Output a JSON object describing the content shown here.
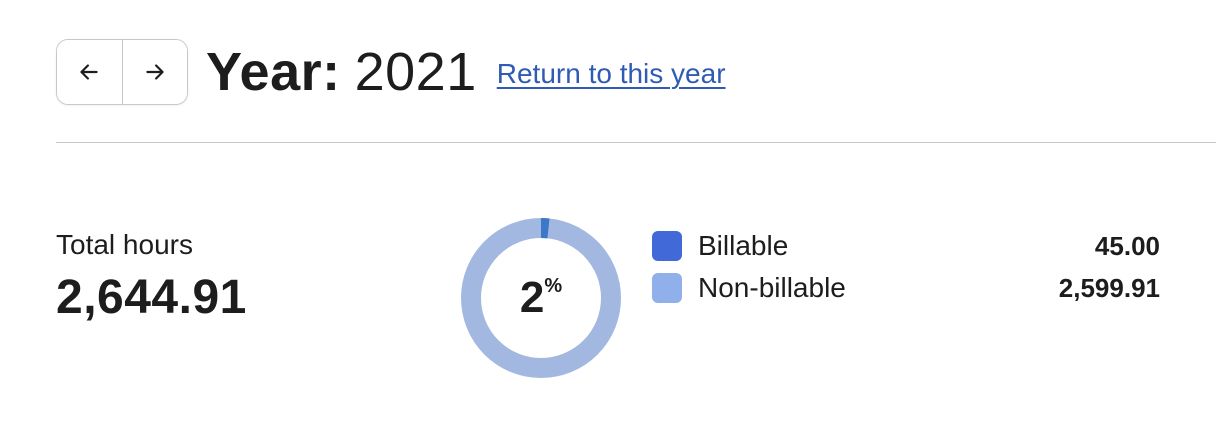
{
  "header": {
    "prev_icon": "arrow-left-icon",
    "next_icon": "arrow-right-icon",
    "title_label": "Year:",
    "title_value": "2021",
    "return_link": "Return to this year"
  },
  "summary": {
    "total_label": "Total hours",
    "total_value": "2,644.91"
  },
  "donut": {
    "percent_value": "2",
    "percent_sign": "%",
    "billable_fraction": 0.017,
    "colors": {
      "billable": "#3b78c9",
      "non_billable": "#a3b8e0"
    }
  },
  "legend": [
    {
      "label": "Billable",
      "value": "45.00",
      "color": "#4169d8"
    },
    {
      "label": "Non-billable",
      "value": "2,599.91",
      "color": "#8fb0ea"
    }
  ]
}
